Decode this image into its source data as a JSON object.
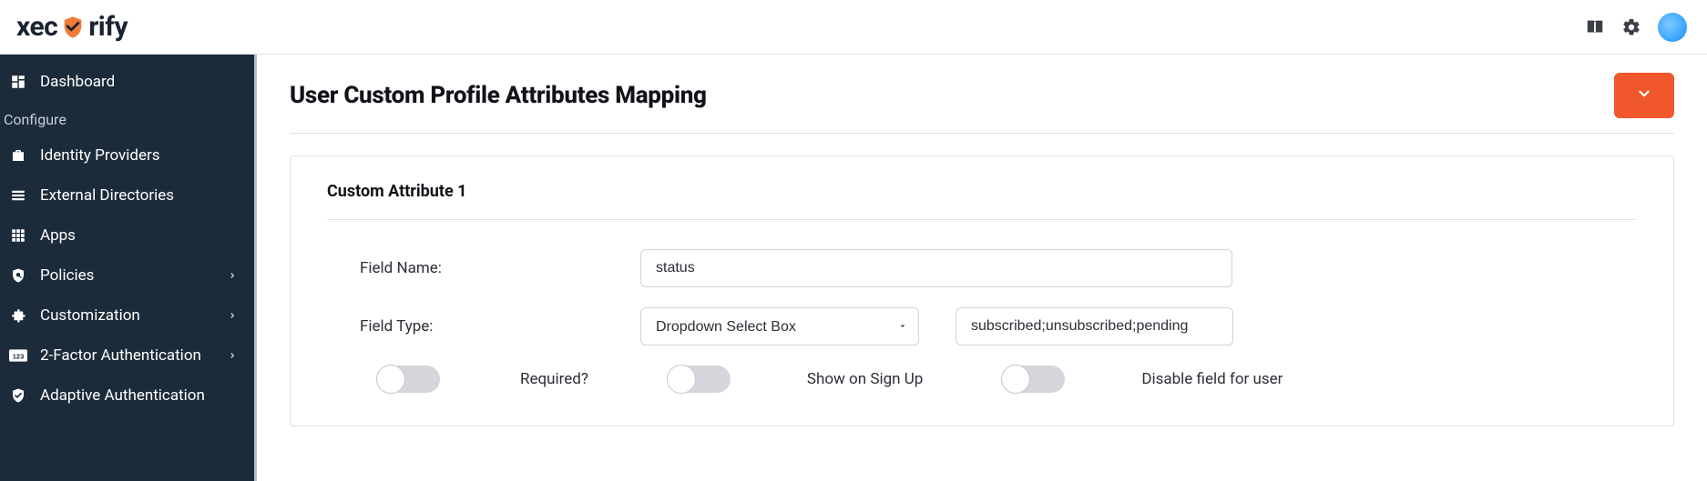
{
  "brand": {
    "part1": "xec",
    "part2": "rify"
  },
  "sidebar": {
    "section_label": "Configure",
    "items": [
      {
        "label": "Dashboard"
      },
      {
        "label": "Identity Providers"
      },
      {
        "label": "External Directories"
      },
      {
        "label": "Apps"
      },
      {
        "label": "Policies",
        "chevron": true
      },
      {
        "label": "Customization",
        "chevron": true
      },
      {
        "label": "2-Factor Authentication",
        "chevron": true
      },
      {
        "label": "Adaptive Authentication"
      }
    ]
  },
  "page": {
    "title": "User Custom Profile Attributes Mapping"
  },
  "attribute": {
    "card_title": "Custom Attribute 1",
    "field_name_label": "Field Name:",
    "field_name_value": "status",
    "field_type_label": "Field Type:",
    "field_type_value": "Dropdown Select Box",
    "field_type_options": [
      "Dropdown Select Box"
    ],
    "options_value": "subscribed;unsubscribed;pending",
    "toggles": {
      "required_label": "Required?",
      "required_on": false,
      "show_on_signup_label": "Show on Sign Up",
      "show_on_signup_on": false,
      "disable_for_user_label": "Disable field for user",
      "disable_for_user_on": false
    }
  }
}
